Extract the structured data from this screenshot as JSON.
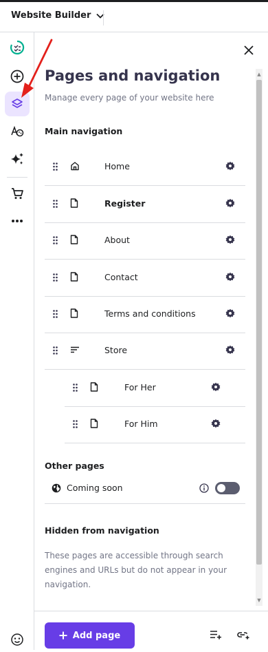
{
  "topbar": {
    "title": "Website Builder"
  },
  "sidebar": {
    "items": [
      {
        "name": "checklist-icon"
      },
      {
        "name": "add-icon"
      },
      {
        "name": "layers-icon",
        "active": true
      },
      {
        "name": "design-icon"
      },
      {
        "name": "ai-sparkle-icon"
      },
      {
        "name": "cart-icon"
      },
      {
        "name": "more-icon"
      },
      {
        "name": "help-icon"
      }
    ]
  },
  "panel": {
    "title": "Pages and navigation",
    "subtitle": "Manage every page of your website here",
    "main_nav_heading": "Main navigation",
    "pages": [
      {
        "label": "Home",
        "icon": "home-icon",
        "bold": false
      },
      {
        "label": "Register",
        "icon": "page-icon",
        "bold": true
      },
      {
        "label": "About",
        "icon": "page-icon",
        "bold": false
      },
      {
        "label": "Contact",
        "icon": "page-icon",
        "bold": false
      },
      {
        "label": "Terms and conditions",
        "icon": "page-icon",
        "bold": false
      },
      {
        "label": "Store",
        "icon": "lines-icon",
        "bold": false
      },
      {
        "label": "For Her",
        "icon": "page-icon",
        "bold": false,
        "child": true
      },
      {
        "label": "For Him",
        "icon": "page-icon",
        "bold": false,
        "child": true
      }
    ],
    "other_heading": "Other pages",
    "coming_soon_label": "Coming soon",
    "coming_soon_enabled": false,
    "hidden_heading": "Hidden from navigation",
    "hidden_description": "These pages are accessible through search engines and URLs but do not appear in your navigation."
  },
  "footer": {
    "add_page_label": "Add page"
  },
  "colors": {
    "accent": "#673de6",
    "active_bg": "#ebe4ff",
    "arrow": "#e3201b",
    "brand_green": "#00b090"
  }
}
